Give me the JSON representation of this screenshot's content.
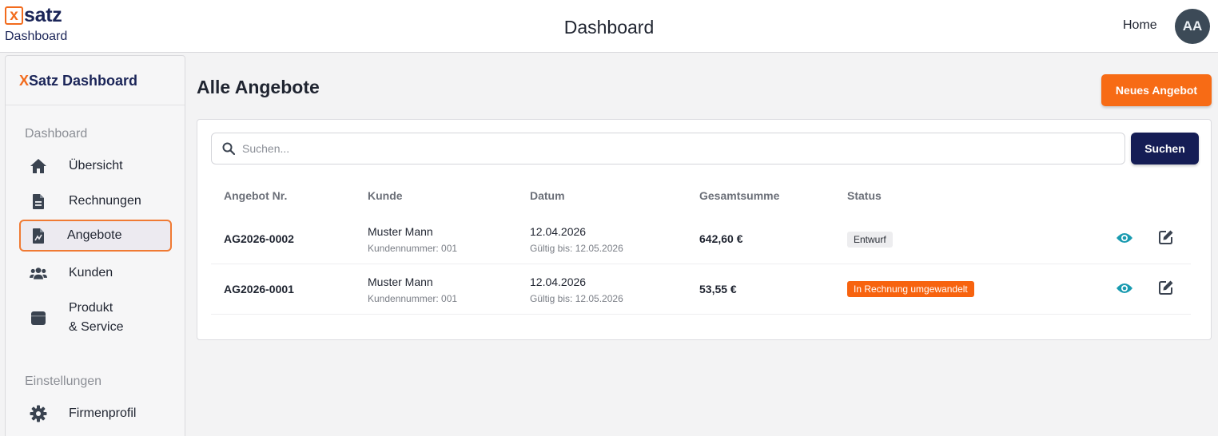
{
  "topbar": {
    "logo_x": "x",
    "logo_word": "satz",
    "logo_sub": "Dashboard",
    "title": "Dashboard",
    "home_label": "Home",
    "avatar_initials": "AA"
  },
  "sidebar": {
    "brand_x": "X",
    "brand_rest": "Satz Dashboard",
    "section_dashboard": "Dashboard",
    "section_settings": "Einstellungen",
    "items": [
      {
        "label": "Übersicht",
        "icon": "home-icon"
      },
      {
        "label": "Rechnungen",
        "icon": "file-icon"
      },
      {
        "label": "Angebote",
        "icon": "file-invoice-icon",
        "active": true
      },
      {
        "label": "Kunden",
        "icon": "users-icon"
      },
      {
        "label": "Produkt",
        "label2": "& Service",
        "icon": "box-icon"
      },
      {
        "label": "Firmenprofil",
        "icon": "gear-icon"
      }
    ]
  },
  "main": {
    "title": "Alle Angebote",
    "new_button": "Neues Angebot",
    "search_placeholder": "Suchen...",
    "search_button": "Suchen",
    "columns": [
      "Angebot Nr.",
      "Kunde",
      "Datum",
      "Gesamtsumme",
      "Status"
    ],
    "rows": [
      {
        "nr": "AG2026-0002",
        "customer": "Muster Mann",
        "customer_no": "Kundennummer: 001",
        "date": "12.04.2026",
        "valid_until": "Gültig bis: 12.05.2026",
        "total": "642,60 €",
        "status": "Entwurf",
        "status_kind": "draft"
      },
      {
        "nr": "AG2026-0001",
        "customer": "Muster Mann",
        "customer_no": "Kundennummer: 001",
        "date": "12.04.2026",
        "valid_until": "Gültig bis: 12.05.2026",
        "total": "53,55 €",
        "status": "In Rechnung umgewandelt",
        "status_kind": "converted"
      }
    ]
  },
  "colors": {
    "accent_orange": "#f76b15",
    "navy": "#151d55",
    "teal_icon": "#1a9bb0"
  }
}
